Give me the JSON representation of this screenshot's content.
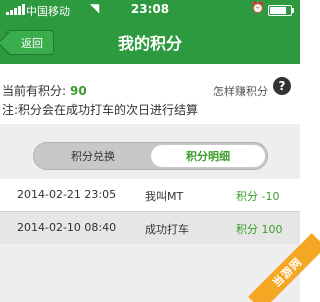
{
  "status_bar": {
    "carrier": "中国移动",
    "time": "23:08",
    "battery_level": 0.8
  },
  "nav": {
    "back_label": "返回",
    "title": "我的积分"
  },
  "info": {
    "points_label": "当前有积分:",
    "points_value": "90",
    "how_to_earn": "怎样赚积分",
    "help_symbol": "?",
    "note": "注:积分会在成功打车的次日进行结算"
  },
  "tabs": {
    "exchange": "积分兑换",
    "detail": "积分明细",
    "selected": "detail"
  },
  "records": [
    {
      "date": "2014-02-21 23:05",
      "description": "我叫MT",
      "points": "积分 -10"
    },
    {
      "date": "2014-02-10 08:40",
      "description": "成功打车",
      "points": "积分 100"
    }
  ],
  "watermark": "当游网",
  "colors": {
    "brand_green": "#2d9a3f",
    "points_green": "#3a9d2a"
  }
}
